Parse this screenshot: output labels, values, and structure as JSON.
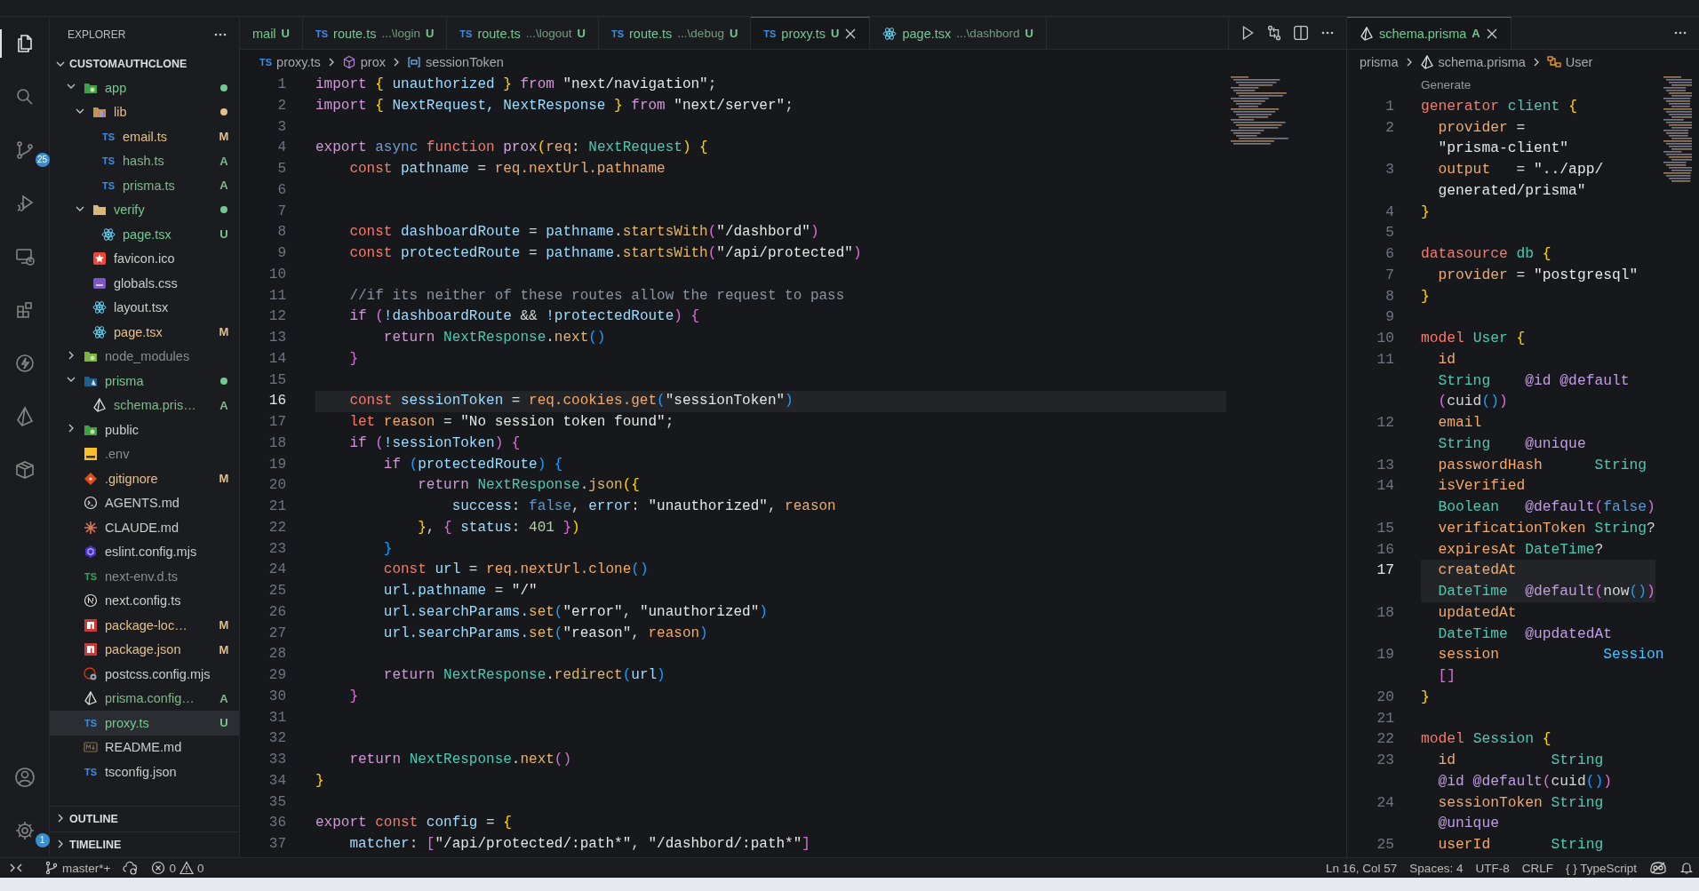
{
  "activity_bar": {
    "items": [
      {
        "kind": "files",
        "selected": true
      },
      {
        "kind": "search",
        "selected": false
      },
      {
        "kind": "source-control",
        "selected": false,
        "badge": "25"
      },
      {
        "kind": "run-debug",
        "selected": false
      },
      {
        "kind": "remote",
        "selected": false
      },
      {
        "kind": "extensions",
        "selected": false
      },
      {
        "kind": "lightning",
        "selected": false
      },
      {
        "kind": "triangle",
        "selected": false
      },
      {
        "kind": "box",
        "selected": false
      }
    ],
    "bottom_items": [
      {
        "kind": "account",
        "selected": false
      },
      {
        "kind": "settings",
        "selected": false,
        "badge": "1"
      }
    ]
  },
  "sidebar": {
    "title": "EXPLORER",
    "root": "CUSTOMAUTHCLONE",
    "tree": [
      {
        "name": "app",
        "kind": "folder-app",
        "color": "#73c991",
        "dot": true,
        "expanded": true,
        "selected": false,
        "children": [
          {
            "name": "lib",
            "kind": "folder-lib",
            "color": "#e2c08d",
            "dot": true,
            "expanded": true,
            "selected": false,
            "children": [
              {
                "name": "email.ts",
                "badge": "TS",
                "kind": "ts",
                "color": "#e2c08d",
                "status": "M",
                "selected": false
              },
              {
                "name": "hash.ts",
                "badge": "TS",
                "kind": "ts",
                "color": "#81b88b",
                "status": "A",
                "selected": false
              },
              {
                "name": "prisma.ts",
                "badge": "TS",
                "kind": "ts",
                "color": "#81b88b",
                "status": "A",
                "selected": false
              }
            ]
          },
          {
            "name": "verify",
            "kind": "folder",
            "color": "#73c991",
            "dot": true,
            "expanded": true,
            "selected": false,
            "children": [
              {
                "name": "page.tsx",
                "kind": "react",
                "color": "#73c991",
                "status": "U",
                "selected": false
              }
            ]
          },
          {
            "name": "favicon.ico",
            "kind": "star",
            "color": "#cccccc",
            "selected": false
          },
          {
            "name": "globals.css",
            "kind": "css",
            "color": "#cccccc",
            "selected": false
          },
          {
            "name": "layout.tsx",
            "kind": "react",
            "color": "#cccccc",
            "selected": false
          },
          {
            "name": "page.tsx",
            "kind": "react",
            "color": "#e2c08d",
            "status": "M",
            "selected": false
          }
        ]
      },
      {
        "name": "node_modules",
        "kind": "folder-node",
        "color": "#8c8c8c",
        "expanded": false,
        "selected": false
      },
      {
        "name": "prisma",
        "kind": "folder-prisma",
        "color": "#73c991",
        "dot": true,
        "expanded": true,
        "selected": false,
        "children": [
          {
            "name": "schema.pris…",
            "kind": "prisma",
            "color": "#81b88b",
            "status": "A",
            "selected": false
          }
        ]
      },
      {
        "name": "public",
        "kind": "folder-public",
        "color": "#cccccc",
        "expanded": false,
        "selected": false
      },
      {
        "name": ".env",
        "kind": "env",
        "color": "#8c8c8c",
        "selected": false
      },
      {
        "name": ".gitignore",
        "kind": "git",
        "color": "#e2c08d",
        "status": "M",
        "selected": false
      },
      {
        "name": "AGENTS.md",
        "kind": "terminal",
        "color": "#cccccc",
        "selected": false
      },
      {
        "name": "CLAUDE.md",
        "kind": "burst",
        "color": "#cccccc",
        "selected": false
      },
      {
        "name": "eslint.config.mjs",
        "kind": "hexagon",
        "color": "#cccccc",
        "selected": false
      },
      {
        "name": "next-env.d.ts",
        "badge": "TS",
        "kind": "ts-declaration",
        "color": "#8c8c8c",
        "selected": false
      },
      {
        "name": "next.config.ts",
        "kind": "circle-slash",
        "color": "#cccccc",
        "selected": false
      },
      {
        "name": "package-loc…",
        "kind": "package",
        "color": "#e2c08d",
        "status": "M",
        "selected": false
      },
      {
        "name": "package.json",
        "kind": "package",
        "color": "#e2c08d",
        "status": "M",
        "selected": false
      },
      {
        "name": "postcss.config.mjs",
        "kind": "gear-circle",
        "color": "#cccccc",
        "selected": false
      },
      {
        "name": "prisma.config…",
        "kind": "prisma",
        "color": "#81b88b",
        "status": "A",
        "selected": false
      },
      {
        "name": "proxy.ts",
        "badge": "TS",
        "kind": "ts",
        "color": "#73c991",
        "status": "U",
        "selected": true
      },
      {
        "name": "README.md",
        "kind": "markdown",
        "color": "#cccccc",
        "selected": false
      },
      {
        "name": "tsconfig.json",
        "badge": "TS",
        "kind": "ts",
        "color": "#cccccc",
        "selected": false
      }
    ],
    "sections": [
      {
        "title": "OUTLINE",
        "expanded": false
      },
      {
        "title": "TIMELINE",
        "expanded": false
      }
    ]
  },
  "editor": {
    "tabs": [
      {
        "label": "mail",
        "status": "U",
        "selected": false
      },
      {
        "label": "route.ts",
        "badge": "TS",
        "description": "...\\login",
        "status": "U",
        "selected": false
      },
      {
        "label": "route.ts",
        "badge": "TS",
        "description": "...\\logout",
        "status": "U",
        "selected": false
      },
      {
        "label": "route.ts",
        "badge": "TS",
        "description": "...\\debug",
        "status": "U",
        "selected": false
      },
      {
        "label": "proxy.ts",
        "badge": "TS",
        "status": "U",
        "selected": true
      },
      {
        "label": "page.tsx",
        "kind": "react",
        "description": "...\\dashbord",
        "status": "U",
        "selected": false
      }
    ],
    "breadcrumbs": [
      {
        "label": "proxy.ts",
        "badge": "TS"
      },
      {
        "label": "prox",
        "kind": "cube"
      },
      {
        "label": "sessionToken",
        "kind": "variable"
      }
    ],
    "lines": [
      {
        "number": "1",
        "current": false,
        "tokens": [
          {
            "text": "import ",
            "kind": "kw"
          },
          {
            "text": "{",
            "kind": "br"
          },
          {
            "text": " unauthorized ",
            "kind": "var"
          },
          {
            "text": "}",
            "kind": "br"
          },
          {
            "text": " from ",
            "kind": "kw"
          },
          {
            "text": "\"next/navigation\"",
            "kind": "str"
          },
          {
            "text": ";",
            "kind": "pn"
          }
        ]
      },
      {
        "number": "2",
        "current": false,
        "tokens": [
          {
            "text": "import ",
            "kind": "kw"
          },
          {
            "text": "{",
            "kind": "br"
          },
          {
            "text": " NextRequest, NextResponse ",
            "kind": "var"
          },
          {
            "text": "}",
            "kind": "br"
          },
          {
            "text": " from ",
            "kind": "kw"
          },
          {
            "text": "\"next/server\"",
            "kind": "str"
          },
          {
            "text": ";",
            "kind": "pn"
          }
        ]
      },
      {
        "number": "3",
        "current": false
      },
      {
        "number": "4",
        "current": false,
        "tokens": [
          {
            "text": "export ",
            "kind": "kw"
          },
          {
            "text": "async ",
            "kind": "mod"
          },
          {
            "text": "function ",
            "kind": "decl"
          },
          {
            "text": "prox",
            "kind": "fname"
          },
          {
            "text": "(",
            "kind": "br"
          },
          {
            "text": "req",
            "kind": "prop"
          },
          {
            "text": ": ",
            "kind": "pn"
          },
          {
            "text": "NextRequest",
            "kind": "type"
          },
          {
            "text": ")",
            "kind": "br"
          },
          {
            "text": " {",
            "kind": "br"
          }
        ]
      },
      {
        "number": "5",
        "current": false,
        "tokens": [
          {
            "text": "    const ",
            "kind": "decl"
          },
          {
            "text": "pathname",
            "kind": "var"
          },
          {
            "text": " = ",
            "kind": "pn"
          },
          {
            "text": "req.nextUrl.pathname",
            "kind": "prop"
          }
        ]
      },
      {
        "number": "6",
        "current": false
      },
      {
        "number": "7",
        "current": false
      },
      {
        "number": "8",
        "current": false,
        "tokens": [
          {
            "text": "    const ",
            "kind": "decl"
          },
          {
            "text": "dashboardRoute",
            "kind": "var"
          },
          {
            "text": " = ",
            "kind": "pn"
          },
          {
            "text": "pathname",
            "kind": "var"
          },
          {
            "text": ".",
            "kind": "pn"
          },
          {
            "text": "startsWith",
            "kind": "fn"
          },
          {
            "text": "(",
            "kind": "br2"
          },
          {
            "text": "\"/dashbord\"",
            "kind": "str"
          },
          {
            "text": ")",
            "kind": "br2"
          }
        ]
      },
      {
        "number": "9",
        "current": false,
        "tokens": [
          {
            "text": "    const ",
            "kind": "decl"
          },
          {
            "text": "protectedRoute",
            "kind": "var"
          },
          {
            "text": " = ",
            "kind": "pn"
          },
          {
            "text": "pathname",
            "kind": "var"
          },
          {
            "text": ".",
            "kind": "pn"
          },
          {
            "text": "startsWith",
            "kind": "fn"
          },
          {
            "text": "(",
            "kind": "br2"
          },
          {
            "text": "\"/api/protected\"",
            "kind": "str"
          },
          {
            "text": ")",
            "kind": "br2"
          }
        ]
      },
      {
        "number": "10",
        "current": false
      },
      {
        "number": "11",
        "current": false,
        "tokens": [
          {
            "text": "    //if its neither of these routes allow the request to pass",
            "kind": "cm"
          }
        ]
      },
      {
        "number": "12",
        "current": false,
        "tokens": [
          {
            "text": "    if ",
            "kind": "kw"
          },
          {
            "text": "(",
            "kind": "br2"
          },
          {
            "text": "!dashboardRoute ",
            "kind": "var"
          },
          {
            "text": "&& ",
            "kind": "pn"
          },
          {
            "text": "!protectedRoute",
            "kind": "var"
          },
          {
            "text": ") {",
            "kind": "br2"
          }
        ]
      },
      {
        "number": "13",
        "current": false,
        "tokens": [
          {
            "text": "        return ",
            "kind": "kw"
          },
          {
            "text": "NextResponse",
            "kind": "type"
          },
          {
            "text": ".",
            "kind": "pn"
          },
          {
            "text": "next",
            "kind": "fn"
          },
          {
            "text": "()",
            "kind": "br3"
          }
        ]
      },
      {
        "number": "14",
        "current": false,
        "tokens": [
          {
            "text": "    }",
            "kind": "br2"
          }
        ]
      },
      {
        "number": "15",
        "current": false
      },
      {
        "number": "16",
        "current": true,
        "tokens": [
          {
            "text": "    const ",
            "kind": "decl"
          },
          {
            "text": "sessionToken",
            "kind": "var"
          },
          {
            "text": " = ",
            "kind": "pn"
          },
          {
            "text": "req.cookies.get",
            "kind": "prop"
          },
          {
            "text": "(",
            "kind": "br3"
          },
          {
            "text": "\"sessionToken\"",
            "kind": "str"
          },
          {
            "text": ")",
            "kind": "br3"
          }
        ]
      },
      {
        "number": "17",
        "current": false,
        "tokens": [
          {
            "text": "    let ",
            "kind": "decl"
          },
          {
            "text": "reason",
            "kind": "prop"
          },
          {
            "text": " = ",
            "kind": "pn"
          },
          {
            "text": "\"No session token found\"",
            "kind": "str"
          },
          {
            "text": ";",
            "kind": "pn"
          }
        ]
      },
      {
        "number": "18",
        "current": false,
        "tokens": [
          {
            "text": "    if ",
            "kind": "kw"
          },
          {
            "text": "(",
            "kind": "br2"
          },
          {
            "text": "!sessionToken",
            "kind": "var"
          },
          {
            "text": ") {",
            "kind": "br2"
          }
        ]
      },
      {
        "number": "19",
        "current": false,
        "tokens": [
          {
            "text": "        if ",
            "kind": "kw"
          },
          {
            "text": "(",
            "kind": "br3"
          },
          {
            "text": "protectedRoute",
            "kind": "var"
          },
          {
            "text": ") {",
            "kind": "br3"
          }
        ]
      },
      {
        "number": "20",
        "current": false,
        "tokens": [
          {
            "text": "            return ",
            "kind": "kw"
          },
          {
            "text": "NextResponse",
            "kind": "type"
          },
          {
            "text": ".",
            "kind": "pn"
          },
          {
            "text": "json",
            "kind": "fn"
          },
          {
            "text": "({",
            "kind": "br"
          }
        ]
      },
      {
        "number": "21",
        "current": false,
        "tokens": [
          {
            "text": "                success",
            "kind": "var"
          },
          {
            "text": ": ",
            "kind": "pn"
          },
          {
            "text": "false",
            "kind": "bool"
          },
          {
            "text": ", ",
            "kind": "pn"
          },
          {
            "text": "error",
            "kind": "var"
          },
          {
            "text": ": ",
            "kind": "pn"
          },
          {
            "text": "\"unauthorized\"",
            "kind": "str"
          },
          {
            "text": ", ",
            "kind": "pn"
          },
          {
            "text": "reason",
            "kind": "prop"
          }
        ]
      },
      {
        "number": "22",
        "current": false,
        "tokens": [
          {
            "text": "            }",
            "kind": "br"
          },
          {
            "text": ", ",
            "kind": "pn"
          },
          {
            "text": "{ ",
            "kind": "br2"
          },
          {
            "text": "status",
            "kind": "var"
          },
          {
            "text": ": ",
            "kind": "pn"
          },
          {
            "text": "401",
            "kind": "num"
          },
          {
            "text": " }",
            "kind": "br2"
          },
          {
            "text": ")",
            "kind": "br"
          }
        ]
      },
      {
        "number": "23",
        "current": false,
        "tokens": [
          {
            "text": "        }",
            "kind": "br3"
          }
        ]
      },
      {
        "number": "24",
        "current": false,
        "tokens": [
          {
            "text": "        const ",
            "kind": "decl"
          },
          {
            "text": "url",
            "kind": "var"
          },
          {
            "text": " = ",
            "kind": "pn"
          },
          {
            "text": "req.nextUrl.clone",
            "kind": "prop"
          },
          {
            "text": "()",
            "kind": "br3"
          }
        ]
      },
      {
        "number": "25",
        "current": false,
        "tokens": [
          {
            "text": "        url.pathname",
            "kind": "var"
          },
          {
            "text": " = ",
            "kind": "pn"
          },
          {
            "text": "\"/\"",
            "kind": "str"
          }
        ]
      },
      {
        "number": "26",
        "current": false,
        "tokens": [
          {
            "text": "        url.searchParams.",
            "kind": "var"
          },
          {
            "text": "set",
            "kind": "fn"
          },
          {
            "text": "(",
            "kind": "br3"
          },
          {
            "text": "\"error\"",
            "kind": "str"
          },
          {
            "text": ", ",
            "kind": "pn"
          },
          {
            "text": "\"unauthorized\"",
            "kind": "str"
          },
          {
            "text": ")",
            "kind": "br3"
          }
        ]
      },
      {
        "number": "27",
        "current": false,
        "tokens": [
          {
            "text": "        url.searchParams.",
            "kind": "var"
          },
          {
            "text": "set",
            "kind": "fn"
          },
          {
            "text": "(",
            "kind": "br3"
          },
          {
            "text": "\"reason\"",
            "kind": "str"
          },
          {
            "text": ", ",
            "kind": "pn"
          },
          {
            "text": "reason",
            "kind": "prop"
          },
          {
            "text": ")",
            "kind": "br3"
          }
        ]
      },
      {
        "number": "28",
        "current": false
      },
      {
        "number": "29",
        "current": false,
        "tokens": [
          {
            "text": "        return ",
            "kind": "kw"
          },
          {
            "text": "NextResponse",
            "kind": "type"
          },
          {
            "text": ".",
            "kind": "pn"
          },
          {
            "text": "redirect",
            "kind": "fn"
          },
          {
            "text": "(",
            "kind": "br3"
          },
          {
            "text": "url",
            "kind": "var"
          },
          {
            "text": ")",
            "kind": "br3"
          }
        ]
      },
      {
        "number": "30",
        "current": false,
        "tokens": [
          {
            "text": "    }",
            "kind": "br2"
          }
        ]
      },
      {
        "number": "31",
        "current": false
      },
      {
        "number": "32",
        "current": false
      },
      {
        "number": "33",
        "current": false,
        "tokens": [
          {
            "text": "    return ",
            "kind": "kw"
          },
          {
            "text": "NextResponse",
            "kind": "type"
          },
          {
            "text": ".",
            "kind": "pn"
          },
          {
            "text": "next",
            "kind": "fn"
          },
          {
            "text": "()",
            "kind": "br2"
          }
        ]
      },
      {
        "number": "34",
        "current": false,
        "tokens": [
          {
            "text": "}",
            "kind": "br"
          }
        ]
      },
      {
        "number": "35",
        "current": false
      },
      {
        "number": "36",
        "current": false,
        "tokens": [
          {
            "text": "export ",
            "kind": "kw"
          },
          {
            "text": "const ",
            "kind": "decl"
          },
          {
            "text": "config",
            "kind": "var"
          },
          {
            "text": " = ",
            "kind": "pn"
          },
          {
            "text": "{",
            "kind": "br"
          }
        ]
      },
      {
        "number": "37",
        "current": false,
        "tokens": [
          {
            "text": "    matcher",
            "kind": "var"
          },
          {
            "text": ": ",
            "kind": "pn"
          },
          {
            "text": "[",
            "kind": "br2"
          },
          {
            "text": "\"/api/protected/:path*\"",
            "kind": "str"
          },
          {
            "text": ", ",
            "kind": "pn"
          },
          {
            "text": "\"/dashbord/:path*\"",
            "kind": "str"
          },
          {
            "text": "]",
            "kind": "br2"
          }
        ]
      }
    ]
  },
  "schema_editor": {
    "tabs": [
      {
        "label": "schema.prisma",
        "kind": "prisma",
        "status": "A",
        "selected": true
      }
    ],
    "breadcrumbs": [
      {
        "label": "prisma"
      },
      {
        "label": "schema.prisma",
        "kind": "prisma"
      },
      {
        "label": "User",
        "kind": "struct"
      }
    ],
    "code_lens": "Generate",
    "rows": [
      {
        "number": "1",
        "current": false,
        "tokens": [
          {
            "text": "generator ",
            "kind": "decl"
          },
          {
            "text": "client ",
            "kind": "type"
          },
          {
            "text": "{",
            "kind": "br"
          }
        ]
      },
      {
        "number": "2",
        "current": false,
        "tokens": [
          {
            "text": "  provider",
            "kind": "prop"
          },
          {
            "text": " =",
            "kind": "pn"
          }
        ]
      },
      {
        "current": false,
        "tokens": [
          {
            "text": "  \"prisma-client\"",
            "kind": "str"
          }
        ]
      },
      {
        "number": "3",
        "current": false,
        "tokens": [
          {
            "text": "  output",
            "kind": "prop"
          },
          {
            "text": "   = ",
            "kind": "pn"
          },
          {
            "text": "\"../app/",
            "kind": "str"
          }
        ]
      },
      {
        "current": false,
        "tokens": [
          {
            "text": "  generated/prisma\"",
            "kind": "str"
          }
        ]
      },
      {
        "number": "4",
        "current": false,
        "tokens": [
          {
            "text": "}",
            "kind": "br"
          }
        ]
      },
      {
        "number": "5",
        "current": false
      },
      {
        "number": "6",
        "current": false,
        "tokens": [
          {
            "text": "datasource ",
            "kind": "decl"
          },
          {
            "text": "db ",
            "kind": "type"
          },
          {
            "text": "{",
            "kind": "br"
          }
        ]
      },
      {
        "number": "7",
        "current": false,
        "tokens": [
          {
            "text": "  provider",
            "kind": "prop"
          },
          {
            "text": " = ",
            "kind": "pn"
          },
          {
            "text": "\"postgresql\"",
            "kind": "str"
          }
        ]
      },
      {
        "number": "8",
        "current": false,
        "tokens": [
          {
            "text": "}",
            "kind": "br"
          }
        ]
      },
      {
        "number": "9",
        "current": false
      },
      {
        "number": "10",
        "current": false,
        "tokens": [
          {
            "text": "model ",
            "kind": "decl"
          },
          {
            "text": "User ",
            "kind": "type"
          },
          {
            "text": "{",
            "kind": "br"
          }
        ]
      },
      {
        "number": "11",
        "current": false,
        "tokens": [
          {
            "text": "  id",
            "kind": "prop"
          }
        ]
      },
      {
        "current": false,
        "tokens": [
          {
            "text": "  String",
            "kind": "type"
          },
          {
            "text": "    @id @default",
            "kind": "attr"
          }
        ]
      },
      {
        "current": false,
        "tokens": [
          {
            "text": "  (",
            "kind": "br2"
          },
          {
            "text": "cuid",
            "kind": "pn"
          },
          {
            "text": "()",
            "kind": "br3"
          },
          {
            "text": ")",
            "kind": "br2"
          }
        ]
      },
      {
        "number": "12",
        "current": false,
        "tokens": [
          {
            "text": "  email",
            "kind": "prop"
          }
        ]
      },
      {
        "current": false,
        "tokens": [
          {
            "text": "  String",
            "kind": "type"
          },
          {
            "text": "    @unique",
            "kind": "attr"
          }
        ]
      },
      {
        "number": "13",
        "current": false,
        "tokens": [
          {
            "text": "  passwordHash",
            "kind": "prop"
          },
          {
            "text": "      String",
            "kind": "type"
          }
        ]
      },
      {
        "number": "14",
        "current": false,
        "tokens": [
          {
            "text": "  isVerified",
            "kind": "prop"
          }
        ]
      },
      {
        "current": false,
        "tokens": [
          {
            "text": "  Boolean",
            "kind": "type"
          },
          {
            "text": "   @default",
            "kind": "attr"
          },
          {
            "text": "(",
            "kind": "br2"
          },
          {
            "text": "false",
            "kind": "bool"
          },
          {
            "text": ")",
            "kind": "br2"
          }
        ]
      },
      {
        "number": "15",
        "current": false,
        "tokens": [
          {
            "text": "  verificationToken",
            "kind": "prop"
          },
          {
            "text": " String",
            "kind": "type"
          },
          {
            "text": "?",
            "kind": "pn"
          }
        ]
      },
      {
        "number": "16",
        "current": false,
        "tokens": [
          {
            "text": "  expiresAt",
            "kind": "prop"
          },
          {
            "text": " DateTime",
            "kind": "type"
          },
          {
            "text": "?",
            "kind": "pn"
          }
        ]
      },
      {
        "number": "17",
        "current": true,
        "tokens": [
          {
            "text": "  createdAt",
            "kind": "prop"
          }
        ]
      },
      {
        "current": true,
        "tokens": [
          {
            "text": "  DateTime",
            "kind": "type"
          },
          {
            "text": "  @default",
            "kind": "attr"
          },
          {
            "text": "(",
            "kind": "br2"
          },
          {
            "text": "now",
            "kind": "pn"
          },
          {
            "text": "()",
            "kind": "br3"
          },
          {
            "text": ")",
            "kind": "br2"
          }
        ]
      },
      {
        "number": "18",
        "current": false,
        "tokens": [
          {
            "text": "  updatedAt",
            "kind": "prop"
          }
        ]
      },
      {
        "current": false,
        "tokens": [
          {
            "text": "  DateTime",
            "kind": "type"
          },
          {
            "text": "  @updatedAt",
            "kind": "attr"
          }
        ]
      },
      {
        "number": "19",
        "current": false,
        "tokens": [
          {
            "text": "  session",
            "kind": "prop"
          },
          {
            "text": "            Session",
            "kind": "ref"
          }
        ]
      },
      {
        "current": false,
        "tokens": [
          {
            "text": "  []",
            "kind": "br2"
          }
        ]
      },
      {
        "number": "20",
        "current": false,
        "tokens": [
          {
            "text": "}",
            "kind": "br"
          }
        ]
      },
      {
        "number": "21",
        "current": false
      },
      {
        "number": "22",
        "current": false,
        "tokens": [
          {
            "text": "model ",
            "kind": "decl"
          },
          {
            "text": "Session ",
            "kind": "type"
          },
          {
            "text": "{",
            "kind": "br"
          }
        ]
      },
      {
        "number": "23",
        "current": false,
        "tokens": [
          {
            "text": "  id",
            "kind": "prop"
          },
          {
            "text": "           String",
            "kind": "type"
          }
        ]
      },
      {
        "current": false,
        "tokens": [
          {
            "text": "  @id @default",
            "kind": "attr"
          },
          {
            "text": "(",
            "kind": "br2"
          },
          {
            "text": "cuid",
            "kind": "pn"
          },
          {
            "text": "()",
            "kind": "br3"
          },
          {
            "text": ")",
            "kind": "br2"
          }
        ]
      },
      {
        "number": "24",
        "current": false,
        "tokens": [
          {
            "text": "  sessionToken",
            "kind": "prop"
          },
          {
            "text": " String",
            "kind": "type"
          }
        ]
      },
      {
        "current": false,
        "tokens": [
          {
            "text": "  @unique",
            "kind": "attr"
          }
        ]
      },
      {
        "number": "25",
        "current": false,
        "tokens": [
          {
            "text": "  userId",
            "kind": "prop"
          },
          {
            "text": "       String",
            "kind": "type"
          }
        ]
      }
    ]
  },
  "status_bar": {
    "branch": "master*+",
    "errors": "0",
    "warnings": "0",
    "right": [
      "Ln 16, Col 57",
      "Spaces: 4",
      "UTF-8",
      "CRLF"
    ],
    "language": "TypeScript",
    "language_icon": "{ }"
  }
}
